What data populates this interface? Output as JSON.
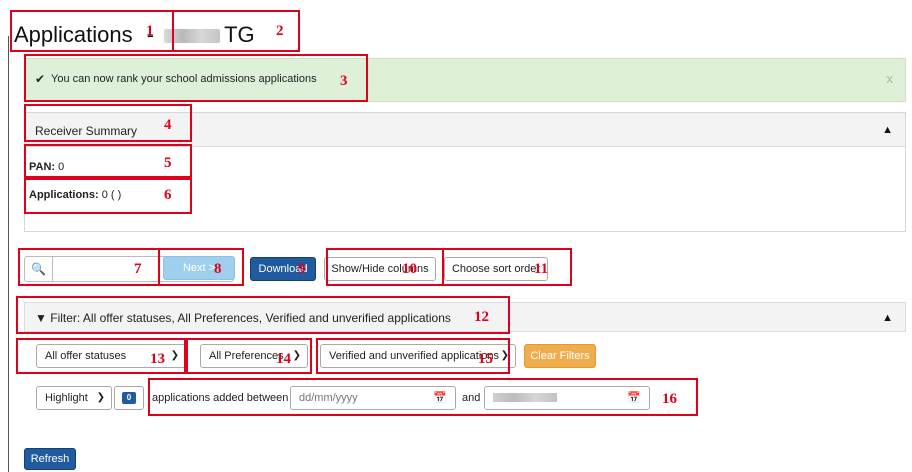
{
  "header": {
    "title": "Applications",
    "separator": "-",
    "suffix": "TG"
  },
  "alert": {
    "message": "You can now rank your school admissions applications",
    "close": "x"
  },
  "receiver_summary": {
    "heading": "Receiver Summary",
    "pan_label": "PAN:",
    "pan_value": "0",
    "applications_label": "Applications:",
    "applications_value": "0 ( )"
  },
  "toolbar": {
    "search_value": "",
    "next_label": "Next >",
    "download_label": "Download",
    "show_hide_label": "Show/Hide columns",
    "sort_label": "Choose sort order"
  },
  "filter": {
    "summary": "Filter: All offer statuses, All Preferences, Verified and unverified applications",
    "offer_status": "All offer statuses",
    "preferences": "All Preferences",
    "verification": "Verified and unverified applications",
    "clear_label": "Clear Filters",
    "highlight_label": "Highlight",
    "highlight_count": "0",
    "added_between_label": "applications added between",
    "from_placeholder": "dd/mm/yyyy",
    "and_label": "and"
  },
  "footer": {
    "refresh_label": "Refresh"
  },
  "markers": [
    "1",
    "2",
    "3",
    "4",
    "5",
    "6",
    "7",
    "8",
    "9",
    "10",
    "11",
    "12",
    "13",
    "14",
    "15",
    "16"
  ],
  "colors": {
    "primary": "#1f5b9e",
    "alert_bg": "#dff0d8",
    "warn": "#f0ad4e",
    "next": "#9ed0ee",
    "annotation": "#e0001b"
  }
}
